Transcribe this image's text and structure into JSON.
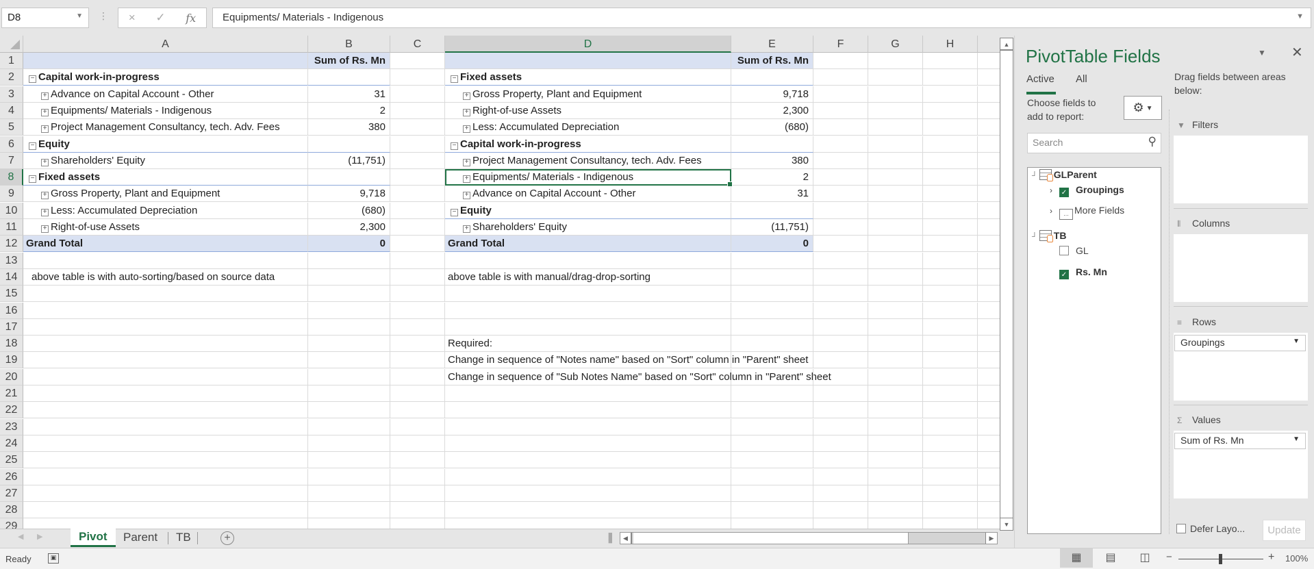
{
  "formula_bar": {
    "name_box": "D8",
    "cancel_icon": "×",
    "enter_icon": "✓",
    "fx_label": "fx",
    "formula": "Equipments/ Materials - Indigenous"
  },
  "columns": [
    "A",
    "B",
    "C",
    "D",
    "E",
    "F",
    "G",
    "H"
  ],
  "rows": [
    "1",
    "2",
    "3",
    "4",
    "5",
    "6",
    "7",
    "8",
    "9",
    "10",
    "11",
    "12",
    "13",
    "14",
    "15",
    "16",
    "17",
    "18",
    "19",
    "20",
    "21",
    "22",
    "23",
    "24",
    "25",
    "26",
    "27",
    "28",
    "29"
  ],
  "pivot_left": {
    "header_value": "Sum of Rs. Mn",
    "rows": [
      {
        "label": "Capital work-in-progress",
        "level": 0,
        "value": ""
      },
      {
        "label": "Advance on Capital Account - Other",
        "level": 1,
        "value": "31"
      },
      {
        "label": "Equipments/ Materials - Indigenous",
        "level": 1,
        "value": "2"
      },
      {
        "label": "Project Management Consultancy, tech. Adv. Fees",
        "level": 1,
        "value": "380"
      },
      {
        "label": "Equity",
        "level": 0,
        "value": ""
      },
      {
        "label": "Shareholders' Equity",
        "level": 1,
        "value": "(11,751)"
      },
      {
        "label": "Fixed assets",
        "level": 0,
        "value": ""
      },
      {
        "label": "Gross Property, Plant and Equipment",
        "level": 1,
        "value": "9,718"
      },
      {
        "label": "Less: Accumulated Depreciation",
        "level": 1,
        "value": "(680)"
      },
      {
        "label": "Right-of-use Assets",
        "level": 1,
        "value": "2,300"
      }
    ],
    "grand_total_label": "Grand Total",
    "grand_total_value": "0",
    "note": "above table is with auto-sorting/based on source data"
  },
  "pivot_right": {
    "header_value": "Sum of Rs. Mn",
    "rows": [
      {
        "label": "Fixed assets",
        "level": 0,
        "value": ""
      },
      {
        "label": "Gross Property, Plant and Equipment",
        "level": 1,
        "value": "9,718"
      },
      {
        "label": "Right-of-use Assets",
        "level": 1,
        "value": "2,300"
      },
      {
        "label": "Less: Accumulated Depreciation",
        "level": 1,
        "value": "(680)"
      },
      {
        "label": "Capital work-in-progress",
        "level": 0,
        "value": ""
      },
      {
        "label": "Project Management Consultancy, tech. Adv. Fees",
        "level": 1,
        "value": "380"
      },
      {
        "label": "Equipments/ Materials - Indigenous",
        "level": 1,
        "value": "2"
      },
      {
        "label": "Advance on Capital Account - Other",
        "level": 1,
        "value": "31"
      },
      {
        "label": "Equity",
        "level": 0,
        "value": ""
      },
      {
        "label": "Shareholders' Equity",
        "level": 1,
        "value": "(11,751)"
      }
    ],
    "grand_total_label": "Grand Total",
    "grand_total_value": "0",
    "note": "above table is with manual/drag-drop-sorting"
  },
  "requirements": {
    "heading": "Required:",
    "line1": "Change in sequence of \"Notes name\" based on \"Sort\" column in \"Parent\" sheet",
    "line2": "Change in sequence of \"Sub Notes Name\" based on \"Sort\" column in \"Parent\" sheet"
  },
  "sheet_tabs": [
    {
      "label": "Pivot",
      "active": true
    },
    {
      "label": "Parent",
      "active": false
    },
    {
      "label": "TB",
      "active": false
    }
  ],
  "status_bar": {
    "status": "Ready",
    "zoom": "100%"
  },
  "pivot_pane": {
    "title": "PivotTable Fields",
    "tabs": [
      "Active",
      "All"
    ],
    "active_tab": "Active",
    "choose_label": "Choose fields to add to report:",
    "search_placeholder": "Search",
    "tables": [
      {
        "name": "GLParent",
        "fields": [
          {
            "label": "Groupings",
            "checked": true
          },
          {
            "label": "More Fields",
            "checked": null
          }
        ]
      },
      {
        "name": "TB",
        "fields": [
          {
            "label": "GL",
            "checked": false
          },
          {
            "label": "Rs. Mn",
            "checked": true
          }
        ]
      }
    ],
    "drag_label": "Drag fields between areas below:",
    "areas": {
      "filters": {
        "label": "Filters",
        "items": []
      },
      "columns": {
        "label": "Columns",
        "items": []
      },
      "rows": {
        "label": "Rows",
        "items": [
          "Groupings"
        ]
      },
      "values": {
        "label": "Values",
        "items": [
          "Sum of Rs. Mn"
        ]
      }
    },
    "defer_label": "Defer Layo...",
    "update_label": "Update"
  },
  "colors": {
    "accent": "#217346",
    "pivot_header": "#d9e1f2",
    "pivot_border": "#8ea9db"
  }
}
